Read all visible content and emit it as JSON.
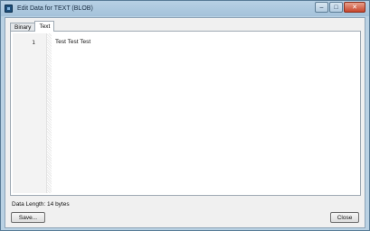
{
  "window": {
    "title": "Edit Data for TEXT (BLOB)",
    "controls": {
      "minimize": "–",
      "maximize": "□",
      "close": "✕"
    }
  },
  "tabs": [
    {
      "label": "Binary",
      "active": false
    },
    {
      "label": "Text",
      "active": true
    }
  ],
  "editor": {
    "lines": [
      {
        "number": "1",
        "text": "Test Test Test"
      }
    ]
  },
  "status": {
    "data_length": "Data Length: 14 bytes"
  },
  "buttons": {
    "save": "Save...",
    "close": "Close"
  }
}
